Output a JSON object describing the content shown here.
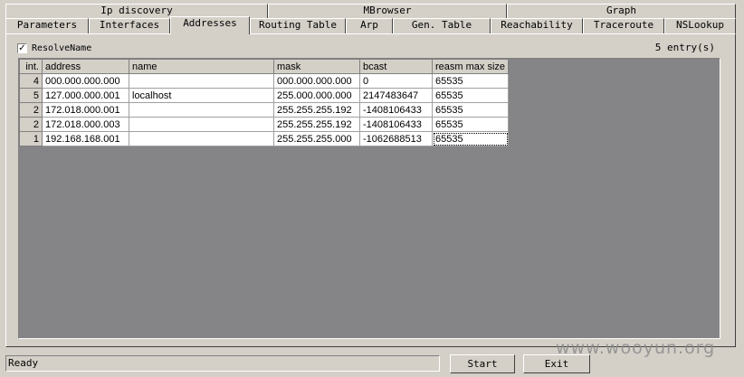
{
  "tabs_row1": [
    {
      "label": "Ip discovery"
    },
    {
      "label": "MBrowser"
    },
    {
      "label": "Graph"
    }
  ],
  "tabs_row2": [
    {
      "label": "Parameters"
    },
    {
      "label": "Interfaces"
    },
    {
      "label": "Addresses",
      "active": true
    },
    {
      "label": "Routing Table"
    },
    {
      "label": "Arp"
    },
    {
      "label": "Gen. Table"
    },
    {
      "label": "Reachability"
    },
    {
      "label": "Traceroute"
    },
    {
      "label": "NSLookup"
    }
  ],
  "resolve_name": {
    "label": "ResolveName",
    "checked": true,
    "check_glyph": "✓"
  },
  "entry_count": "5 entry(s)",
  "table": {
    "columns": [
      "int.",
      "address",
      "name",
      "mask",
      "bcast",
      "reasm max size"
    ],
    "rows": [
      [
        "4",
        "000.000.000.000",
        "",
        "000.000.000.000",
        "0",
        "65535"
      ],
      [
        "5",
        "127.000.000.001",
        "localhost",
        "255.000.000.000",
        "2147483647",
        "65535"
      ],
      [
        "2",
        "172.018.000.001",
        "",
        "255.255.255.192",
        "-1408106433",
        "65535"
      ],
      [
        "2",
        "172.018.000.003",
        "",
        "255.255.255.192",
        "-1408106433",
        "65535"
      ],
      [
        "1",
        "192.168.168.001",
        "",
        "255.255.255.000",
        "-1062688513",
        "65535"
      ]
    ]
  },
  "status_text": "Ready",
  "buttons": {
    "start": "Start",
    "exit": "Exit"
  },
  "watermark": "www.wooyun.org"
}
